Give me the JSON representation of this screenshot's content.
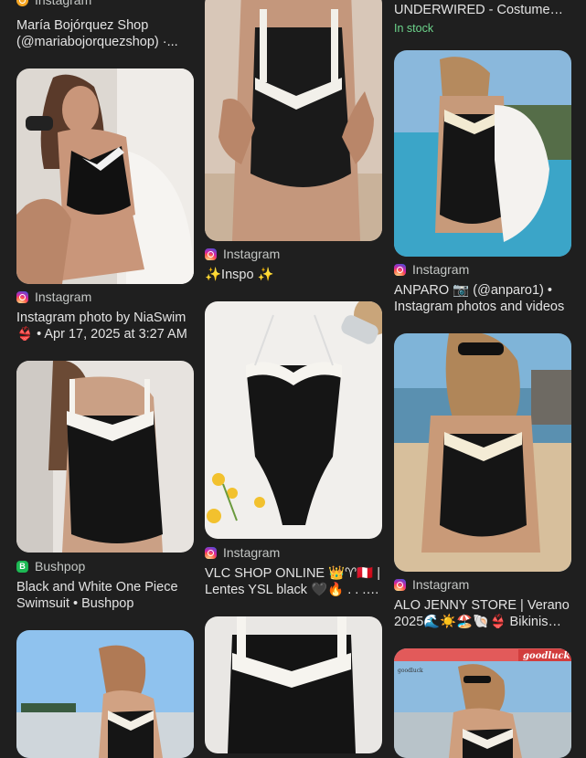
{
  "columns": [
    {
      "cards": [
        {
          "source": "Instagram",
          "title": "María Bojórquez Shop (@mariabojorquezshop) ·..."
        },
        {
          "source": "Instagram",
          "title": "Instagram photo by NiaSwim 👙 • Apr 17, 2025 at 3:27 AM"
        },
        {
          "source": "Bushpop",
          "title": "Black and White One Piece Swimsuit • Bushpop"
        },
        {
          "source": "",
          "title": ""
        }
      ]
    },
    {
      "cards": [
        {
          "source": "Instagram",
          "title": "✨Inspo ✨"
        },
        {
          "source": "Instagram",
          "title": "VLC SHOP ONLINE 👑♈🇵🇪 | Lentes YSL black 🖤🔥 . . . . ...."
        },
        {
          "source": "",
          "title": ""
        }
      ]
    },
    {
      "cards": [
        {
          "title": "UNDERWIRED - Costume da...",
          "stock": "In stock"
        },
        {
          "source": "Instagram",
          "title": "ANPARO 📷 (@anparo1) • Instagram photos and videos"
        },
        {
          "source": "Instagram",
          "title": "ALO JENNY STORE | Verano 2025🌊☀️🏖️🐚👙 Bikinis on..."
        },
        {
          "badge": "goodluck",
          "source": "",
          "title": ""
        }
      ]
    }
  ]
}
